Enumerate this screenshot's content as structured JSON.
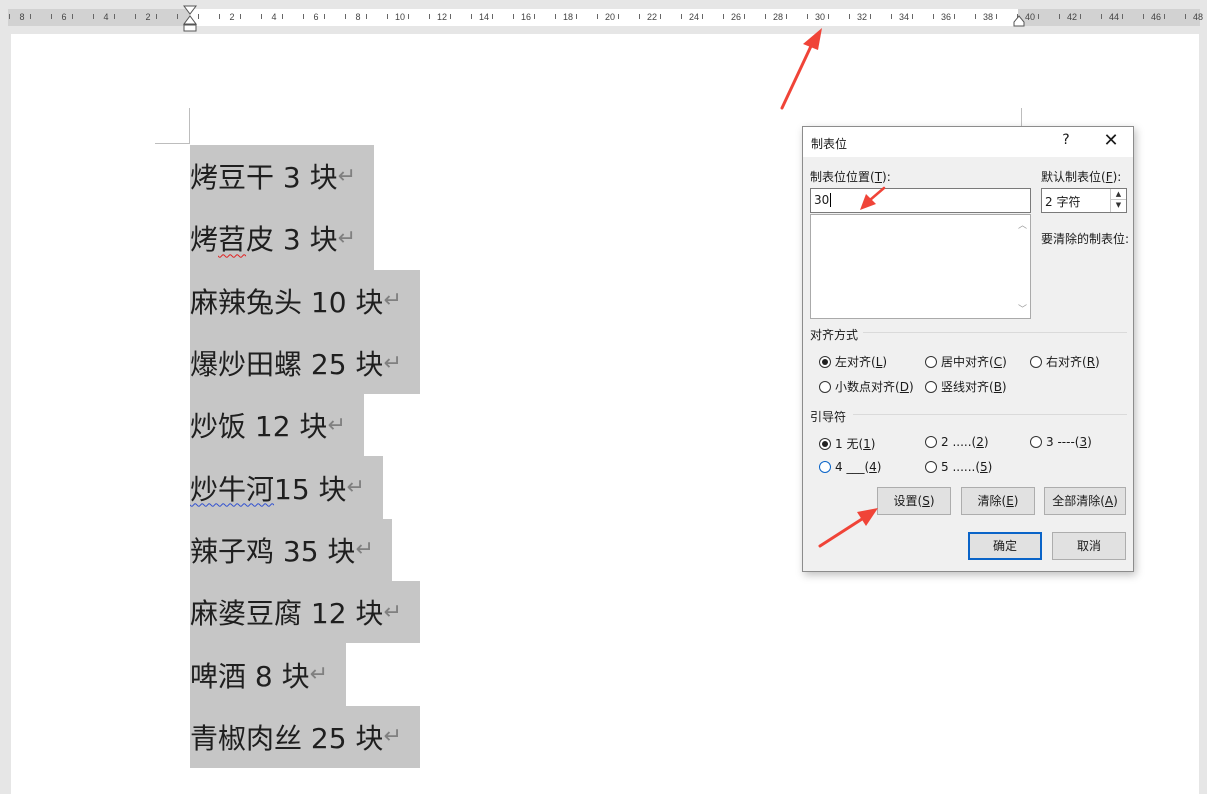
{
  "ruler": {
    "labels": [
      "8",
      "6",
      "4",
      "2",
      "2",
      "4",
      "6",
      "8",
      "10",
      "12",
      "14",
      "16",
      "18",
      "20",
      "22",
      "24",
      "26",
      "28",
      "30",
      "32",
      "34",
      "36",
      "38",
      "40",
      "42",
      "44",
      "46",
      "48"
    ]
  },
  "document": {
    "lines": [
      {
        "text": "烤豆干 3 块",
        "para_mark": "↵"
      },
      {
        "pre": "烤",
        "squiggle": "苕",
        "post": "皮 3 块",
        "para_mark": "↵"
      },
      {
        "text": "麻辣兔头 10 块",
        "para_mark": "↵"
      },
      {
        "text": "爆炒田螺 25 块",
        "para_mark": "↵"
      },
      {
        "text": "炒饭 12 块",
        "para_mark": "↵"
      },
      {
        "squiggle": "炒牛河",
        "post": " 15 块",
        "para_mark": "↵"
      },
      {
        "text": "辣子鸡 35 块",
        "para_mark": "↵"
      },
      {
        "text": "麻婆豆腐 12 块",
        "para_mark": "↵"
      },
      {
        "text": "啤酒 8 块",
        "para_mark": "↵"
      },
      {
        "text": "青椒肉丝 25 块",
        "para_mark": "↵"
      }
    ]
  },
  "dialog": {
    "title": "制表位",
    "help_label": "?",
    "close_label": "✕",
    "position_label_pre": "制表位位置(",
    "position_label_key": "T",
    "position_label_post": "):",
    "position_value": "30",
    "default_label_pre": "默认制表位(",
    "default_label_key": "F",
    "default_label_post": "):",
    "default_value": "2 字符",
    "clear_label": "要清除的制表位:",
    "alignment_label": "对齐方式",
    "alignment_options": [
      {
        "pre": "左对齐(",
        "key": "L",
        "post": ")",
        "checked": true
      },
      {
        "pre": "居中对齐(",
        "key": "C",
        "post": ")",
        "checked": false
      },
      {
        "pre": "右对齐(",
        "key": "R",
        "post": ")",
        "checked": false
      },
      {
        "pre": "小数点对齐(",
        "key": "D",
        "post": ")",
        "checked": false
      },
      {
        "pre": "竖线对齐(",
        "key": "B",
        "post": ")",
        "checked": false
      }
    ],
    "leader_label": "引导符",
    "leader_options": [
      {
        "pre": "1 无(",
        "key": "1",
        "post": ")",
        "checked": true
      },
      {
        "pre": "2 .....(",
        "key": "2",
        "post": ")",
        "checked": false
      },
      {
        "pre": "3 ----(",
        "key": "3",
        "post": ")",
        "checked": false
      },
      {
        "pre": "4 ___(",
        "key": "4",
        "post": ")",
        "checked": false
      },
      {
        "pre": "5 ......(",
        "key": "5",
        "post": ")",
        "checked": false
      }
    ],
    "buttons": {
      "set": {
        "pre": "设置(",
        "key": "S",
        "post": ")"
      },
      "clear": {
        "pre": "清除(",
        "key": "E",
        "post": ")"
      },
      "clear_all": {
        "pre": "全部清除(",
        "key": "A",
        "post": ")"
      },
      "ok": "确定",
      "cancel": "取消"
    }
  },
  "colors": {
    "highlight": "#c6c6c6",
    "annotation_arrow": "#f04438",
    "focus_blue": "#0a64c8"
  }
}
